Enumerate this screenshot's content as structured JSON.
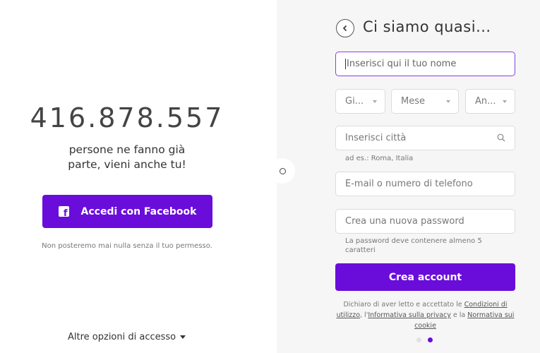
{
  "left": {
    "member_count": "416.878.557",
    "tagline_line1": "persone ne fanno già",
    "tagline_line2": "parte, vieni anche tu!",
    "facebook_button": "Accedi con Facebook",
    "facebook_note": "Non posteremo mai nulla senza il tuo permesso.",
    "other_options": "Altre opzioni di accesso"
  },
  "form": {
    "title": "Ci siamo quasi...",
    "name_placeholder": "Inserisci qui il tuo nome",
    "day_label": "Gi...",
    "month_label": "Mese",
    "year_label": "An...",
    "city_placeholder": "Inserisci città",
    "city_hint": "ad es.: Roma, Italia",
    "email_placeholder": "E-mail o numero di telefono",
    "password_placeholder": "Crea una nuova password",
    "password_hint_line1": "La password deve contenere almeno 5",
    "password_hint_line2": "caratteri",
    "create_button": "Crea account",
    "legal_1": "Dichiaro di aver letto e accettato le ",
    "legal_link_conditions": "Condizioni di utilizzo",
    "legal_2": ", l'",
    "legal_link_privacy": "Informativa sulla privacy",
    "legal_3": " e la ",
    "legal_link_cookie": "Normativa sui cookie"
  },
  "colors": {
    "brand_purple": "#6a0ddb",
    "active_border": "#8a3ee0"
  },
  "pagination": {
    "total": 2,
    "current": 2
  }
}
